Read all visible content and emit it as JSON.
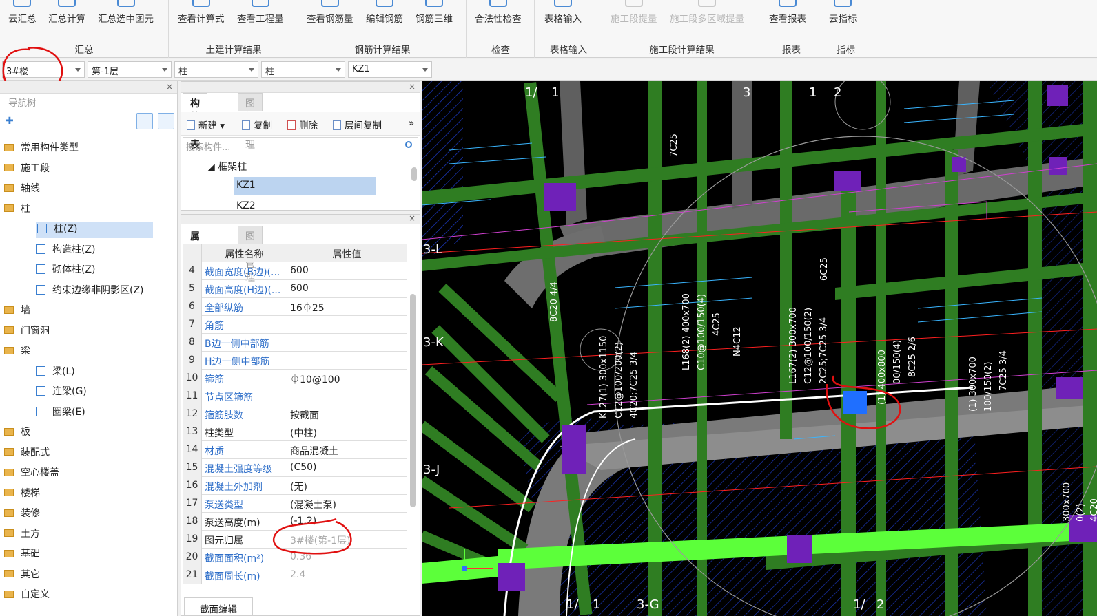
{
  "ribbon": {
    "groups": [
      {
        "title": "汇总",
        "buttons": [
          "云汇总",
          "汇总计算",
          "汇总选中图元"
        ]
      },
      {
        "title": "土建计算结果",
        "buttons": [
          "查看计算式",
          "查看工程量"
        ]
      },
      {
        "title": "钢筋计算结果",
        "buttons": [
          "查看钢筋量",
          "编辑钢筋",
          "钢筋三维"
        ]
      },
      {
        "title": "检查",
        "buttons": [
          "合法性检查"
        ]
      },
      {
        "title": "表格输入",
        "buttons": [
          "表格输入"
        ]
      },
      {
        "title": "施工段计算结果",
        "buttons": [
          "施工段提量",
          "施工段多区域提量"
        ]
      },
      {
        "title": "报表",
        "buttons": [
          "查看报表"
        ]
      },
      {
        "title": "指标",
        "buttons": [
          "云指标"
        ]
      }
    ]
  },
  "selectors": {
    "building": "3#楼",
    "floor": "第-1层",
    "type": "柱",
    "subtype": "柱",
    "component": "KZ1"
  },
  "nav": {
    "title": "导航树",
    "items": [
      {
        "label": "常用构件类型",
        "kind": "folder"
      },
      {
        "label": "施工段",
        "kind": "folder"
      },
      {
        "label": "轴线",
        "kind": "folder"
      },
      {
        "label": "柱",
        "kind": "folder-open"
      },
      {
        "label": "柱(Z)",
        "kind": "child",
        "selected": true
      },
      {
        "label": "构造柱(Z)",
        "kind": "child"
      },
      {
        "label": "砌体柱(Z)",
        "kind": "child"
      },
      {
        "label": "约束边缘非阴影区(Z)",
        "kind": "child"
      },
      {
        "label": "墙",
        "kind": "folder"
      },
      {
        "label": "门窗洞",
        "kind": "folder"
      },
      {
        "label": "梁",
        "kind": "folder-open"
      },
      {
        "label": "梁(L)",
        "kind": "child"
      },
      {
        "label": "连梁(G)",
        "kind": "child"
      },
      {
        "label": "圈梁(E)",
        "kind": "child"
      },
      {
        "label": "板",
        "kind": "folder"
      },
      {
        "label": "装配式",
        "kind": "folder"
      },
      {
        "label": "空心楼盖",
        "kind": "folder"
      },
      {
        "label": "楼梯",
        "kind": "folder"
      },
      {
        "label": "装修",
        "kind": "folder"
      },
      {
        "label": "土方",
        "kind": "folder"
      },
      {
        "label": "基础",
        "kind": "folder"
      },
      {
        "label": "其它",
        "kind": "folder"
      },
      {
        "label": "自定义",
        "kind": "folder"
      }
    ]
  },
  "component_list": {
    "tabs": [
      "构件列表",
      "图纸管理"
    ],
    "toolbar": [
      "新建",
      "复制",
      "删除",
      "层间复制"
    ],
    "search_placeholder": "搜索构件...",
    "group": "框架柱",
    "items": [
      "KZ1",
      "KZ2"
    ]
  },
  "properties": {
    "tabs": [
      "属性列表",
      "图层管理"
    ],
    "header": {
      "name": "属性名称",
      "value": "属性值"
    },
    "rows": [
      {
        "no": "4",
        "name": "截面宽度(B边)(...",
        "value": "600",
        "link": true
      },
      {
        "no": "5",
        "name": "截面高度(H边)(...",
        "value": "600",
        "link": true
      },
      {
        "no": "6",
        "name": "全部纵筋",
        "value": "16⏀25",
        "link": true
      },
      {
        "no": "7",
        "name": "角筋",
        "value": "",
        "link": true
      },
      {
        "no": "8",
        "name": "B边一侧中部筋",
        "value": "",
        "link": true
      },
      {
        "no": "9",
        "name": "H边一侧中部筋",
        "value": "",
        "link": true
      },
      {
        "no": "10",
        "name": "箍筋",
        "value": "⏀10@100",
        "link": true
      },
      {
        "no": "11",
        "name": "节点区箍筋",
        "value": "",
        "link": true
      },
      {
        "no": "12",
        "name": "箍筋肢数",
        "value": "按截面",
        "link": true
      },
      {
        "no": "13",
        "name": "柱类型",
        "value": "(中柱)",
        "link": false
      },
      {
        "no": "14",
        "name": "材质",
        "value": "商品混凝土",
        "link": true
      },
      {
        "no": "15",
        "name": "混凝土强度等级",
        "value": "(C50)",
        "link": true
      },
      {
        "no": "16",
        "name": "混凝土外加剂",
        "value": "(无)",
        "link": true
      },
      {
        "no": "17",
        "name": "泵送类型",
        "value": "(混凝土泵)",
        "link": true
      },
      {
        "no": "18",
        "name": "泵送高度(m)",
        "value": "(-1.2)",
        "link": false
      },
      {
        "no": "19",
        "name": "图元归属",
        "value": "3#楼(第-1层)",
        "link": false,
        "grey": true
      },
      {
        "no": "20",
        "name": "截面面积(m²)",
        "value": "0.36",
        "link": true,
        "grey": true
      },
      {
        "no": "21",
        "name": "截面周长(m)",
        "value": "2.4",
        "link": true,
        "grey": true
      }
    ],
    "bottom_tab": "截面编辑"
  },
  "canvas": {
    "labels": [
      "1/",
      "1",
      "3",
      "1",
      "2",
      "3-L",
      "3-K",
      "3-J",
      "3-G",
      "1/",
      "1",
      "1/",
      "2"
    ],
    "rebar_texts": [
      "KL27(1) 300x1150",
      "C12@100/200(2)",
      "4C20;7C25 3/4",
      "L168(2) 400x700",
      "C10@100/150(4)",
      "4C25",
      "N4C12",
      "L167(2) 300x700",
      "C12@100/150(2)",
      "2C25;7C25 3/4",
      "(1) 400x800",
      "00/150(4)",
      "8C25 2/6",
      "(1) 300x700",
      "100/150(2)",
      "7C25 3/4",
      "6C25",
      "7C25",
      "8C20 4/4",
      "300x700",
      "0(2)",
      "4C20"
    ]
  },
  "colors": {
    "beam_green": "#2f7d22",
    "beam_bright": "#5cff3a",
    "column_purple": "#6f21b8",
    "selected_blue": "#1f6fff",
    "axis_red": "#ff2020",
    "annotation_red": "#e01010"
  }
}
